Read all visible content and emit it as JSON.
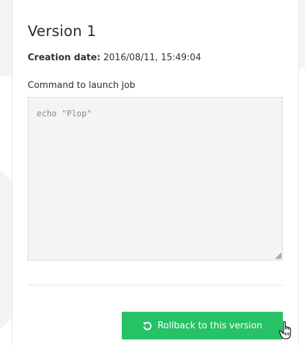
{
  "version": {
    "title": "Version 1",
    "creation_label": "Creation date:",
    "creation_value": "2016/08/11, 15:49:04"
  },
  "command": {
    "label": "Command to launch job",
    "value": "echo \"Plop\""
  },
  "actions": {
    "rollback_label": "Rollback to this version",
    "rollback_icon": "rotate-ccw-icon",
    "accent_color": "#27c266"
  },
  "pointer": {
    "icon": "hand-pointer-icon"
  }
}
